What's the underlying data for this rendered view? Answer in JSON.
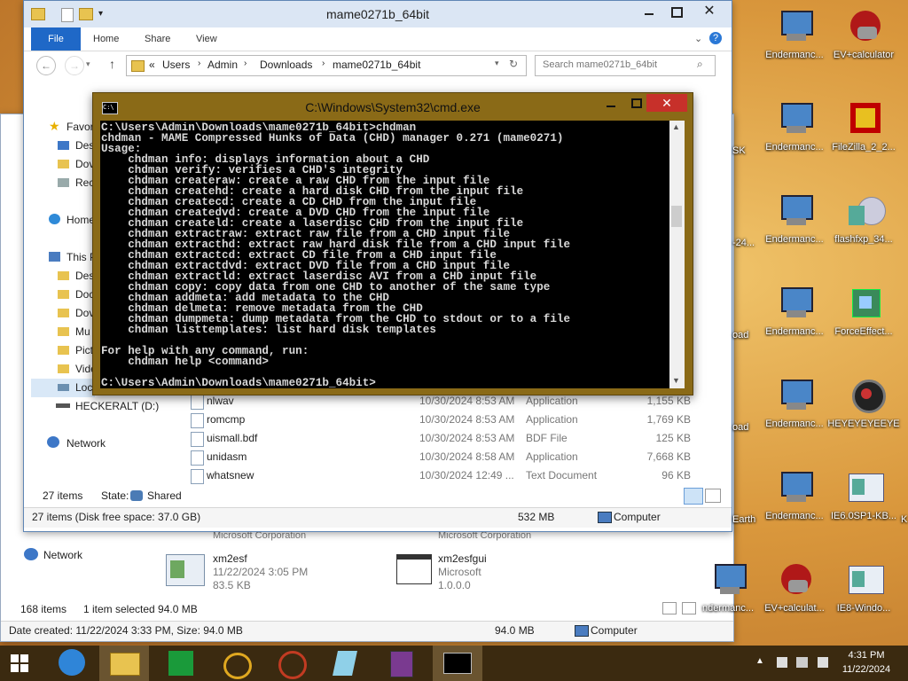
{
  "explorer_back": {
    "network_label": "Network",
    "items_count": "168 items",
    "selection": "1 item selected  94.0 MB",
    "date_status": "Date created: 11/22/2024 3:33 PM, Size: 94.0 MB",
    "size_status": "94.0 MB",
    "computer_label": "Computer",
    "tile1_name": "xm2esf",
    "tile1_date": "11/22/2024 3:05 PM",
    "tile1_size": "83.5 KB",
    "tile2_name": "xm2esfgui",
    "tile2_company": "Microsoft",
    "tile2_version": "1.0.0.0",
    "company_left": "Microsoft Corporation",
    "company_right": "Microsoft Corporation"
  },
  "explorer": {
    "title": "mame0271b_64bit",
    "tabs": {
      "file": "File",
      "home": "Home",
      "share": "Share",
      "view": "View"
    },
    "breadcrumb": {
      "prefix": "«",
      "p1": "Users",
      "p2": "Admin",
      "p3": "Downloads",
      "p4": "mame0271b_64bit"
    },
    "search_placeholder": "Search mame0271b_64bit",
    "sidebar": {
      "favorites": "Favor",
      "desktop": "Des",
      "downloads": "Dov",
      "recent": "Rec",
      "homegroup": "Home",
      "thispc": "This P",
      "pc_desktop": "Des",
      "documents": "Doc",
      "pc_downloads": "Dov",
      "music": "Mu",
      "pictures": "Pict",
      "videos": "Vide",
      "local": "Loc",
      "drive": "HECKERALT (D:)",
      "network": "Network"
    },
    "files": [
      {
        "name": "nlwav",
        "date": "10/30/2024 8:53 AM",
        "type": "Application",
        "size": "1,155 KB"
      },
      {
        "name": "romcmp",
        "date": "10/30/2024 8:53 AM",
        "type": "Application",
        "size": "1,769 KB"
      },
      {
        "name": "uismall.bdf",
        "date": "10/30/2024 8:53 AM",
        "type": "BDF File",
        "size": "125 KB"
      },
      {
        "name": "unidasm",
        "date": "10/30/2024 8:58 AM",
        "type": "Application",
        "size": "7,668 KB"
      },
      {
        "name": "whatsnew",
        "date": "10/30/2024 12:49 ...",
        "type": "Text Document",
        "size": "96 KB"
      }
    ],
    "items_count": "27 items",
    "state_label": "State:",
    "state_value": "Shared",
    "status_left": "27 items (Disk free space: 37.0 GB)",
    "status_size": "532 MB",
    "status_computer": "Computer"
  },
  "cmd": {
    "title": "C:\\Windows\\System32\\cmd.exe",
    "output": "C:\\Users\\Admin\\Downloads\\mame0271b_64bit>chdman\nchdman - MAME Compressed Hunks of Data (CHD) manager 0.271 (mame0271)\nUsage:\n    chdman info: displays information about a CHD\n    chdman verify: verifies a CHD's integrity\n    chdman createraw: create a raw CHD from the input file\n    chdman createhd: create a hard disk CHD from the input file\n    chdman createcd: create a CD CHD from the input file\n    chdman createdvd: create a DVD CHD from the input file\n    chdman createld: create a laserdisc CHD from the input file\n    chdman extractraw: extract raw file from a CHD input file\n    chdman extracthd: extract raw hard disk file from a CHD input file\n    chdman extractcd: extract CD file from a CHD input file\n    chdman extractdvd: extract DVD file from a CHD input file\n    chdman extractld: extract laserdisc AVI from a CHD input file\n    chdman copy: copy data from one CHD to another of the same type\n    chdman addmeta: add metadata to the CHD\n    chdman delmeta: remove metadata from the CHD\n    chdman dumpmeta: dump metadata from the CHD to stdout or to a file\n    chdman listtemplates: list hard disk templates\n\nFor help with any command, run:\n    chdman help <command>\n\nC:\\Users\\Admin\\Downloads\\mame0271b_64bit>"
  },
  "desktop_icons": [
    {
      "label": "Endermanc..."
    },
    {
      "label": "EV+calculator"
    },
    {
      "label": "Endermanc..."
    },
    {
      "label": "FileZilla_2_2..."
    },
    {
      "label": "Endermanc..."
    },
    {
      "label": "flashfxp_34..."
    },
    {
      "label": "Endermanc..."
    },
    {
      "label": "ForceEffect..."
    },
    {
      "label": "Endermanc..."
    },
    {
      "label": "HEYEYEYEEYE"
    },
    {
      "label": "Endermanc..."
    },
    {
      "label": "IE6.0SP1-KB..."
    },
    {
      "label": "ndermanc..."
    },
    {
      "label": "EV+calculat..."
    },
    {
      "label": "IE8-Windo..."
    }
  ],
  "edge_labels": {
    "sk": "SK",
    "n24": "-24...",
    "oad1": "oad",
    "oad2": "oad",
    "earth": "Earth",
    "kb": "K"
  },
  "taskbar": {
    "time": "4:31 PM",
    "date": "11/22/2024"
  }
}
